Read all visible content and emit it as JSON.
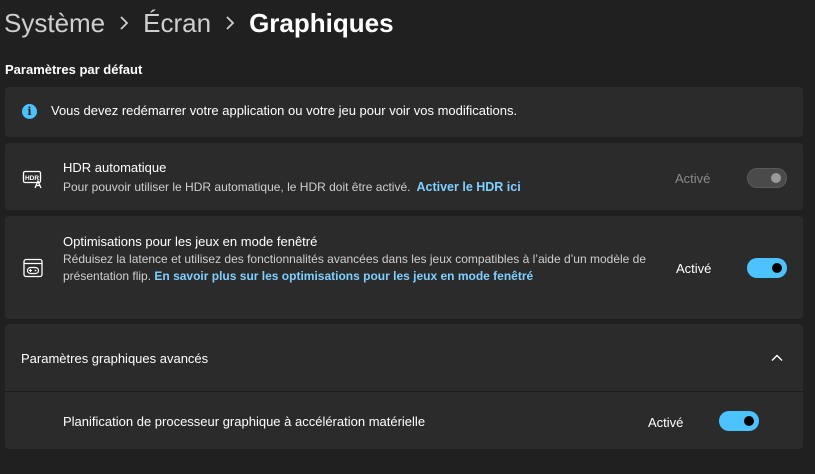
{
  "breadcrumb": {
    "items": [
      "Système",
      "Écran"
    ],
    "current": "Graphiques"
  },
  "section_title": "Paramètres par défaut",
  "info_banner": {
    "text": "Vous devez redémarrer votre application ou votre jeu pour voir vos modifications.",
    "icon": "info-icon"
  },
  "hdr": {
    "icon": "hdr-icon",
    "title": "HDR automatique",
    "description": "Pour pouvoir utiliser le HDR automatique, le HDR doit être activé.",
    "link": "Activer le HDR ici",
    "state_label": "Activé",
    "toggle_state": "on-disabled"
  },
  "windowed_opt": {
    "icon": "game-window-icon",
    "title": "Optimisations pour les jeux en mode fenêtré",
    "description": "Réduisez la latence et utilisez des fonctionnalités avancées dans les jeux compatibles à l’aide d’un modèle de présentation flip.",
    "link": "En savoir plus sur les optimisations pour les jeux en mode fenêtré",
    "state_label": "Activé",
    "toggle_state": "on"
  },
  "advanced": {
    "title": "Paramètres graphiques avancés",
    "expanded": true,
    "chevron_icon": "chevron-up-icon",
    "hags": {
      "label": "Planification de processeur graphique à accélération matérielle",
      "state_label": "Activé",
      "toggle_state": "on"
    }
  },
  "colors": {
    "background": "#202020",
    "card": "#2b2b2b",
    "accent": "#4cc2ff",
    "link": "#7fd0ff"
  }
}
